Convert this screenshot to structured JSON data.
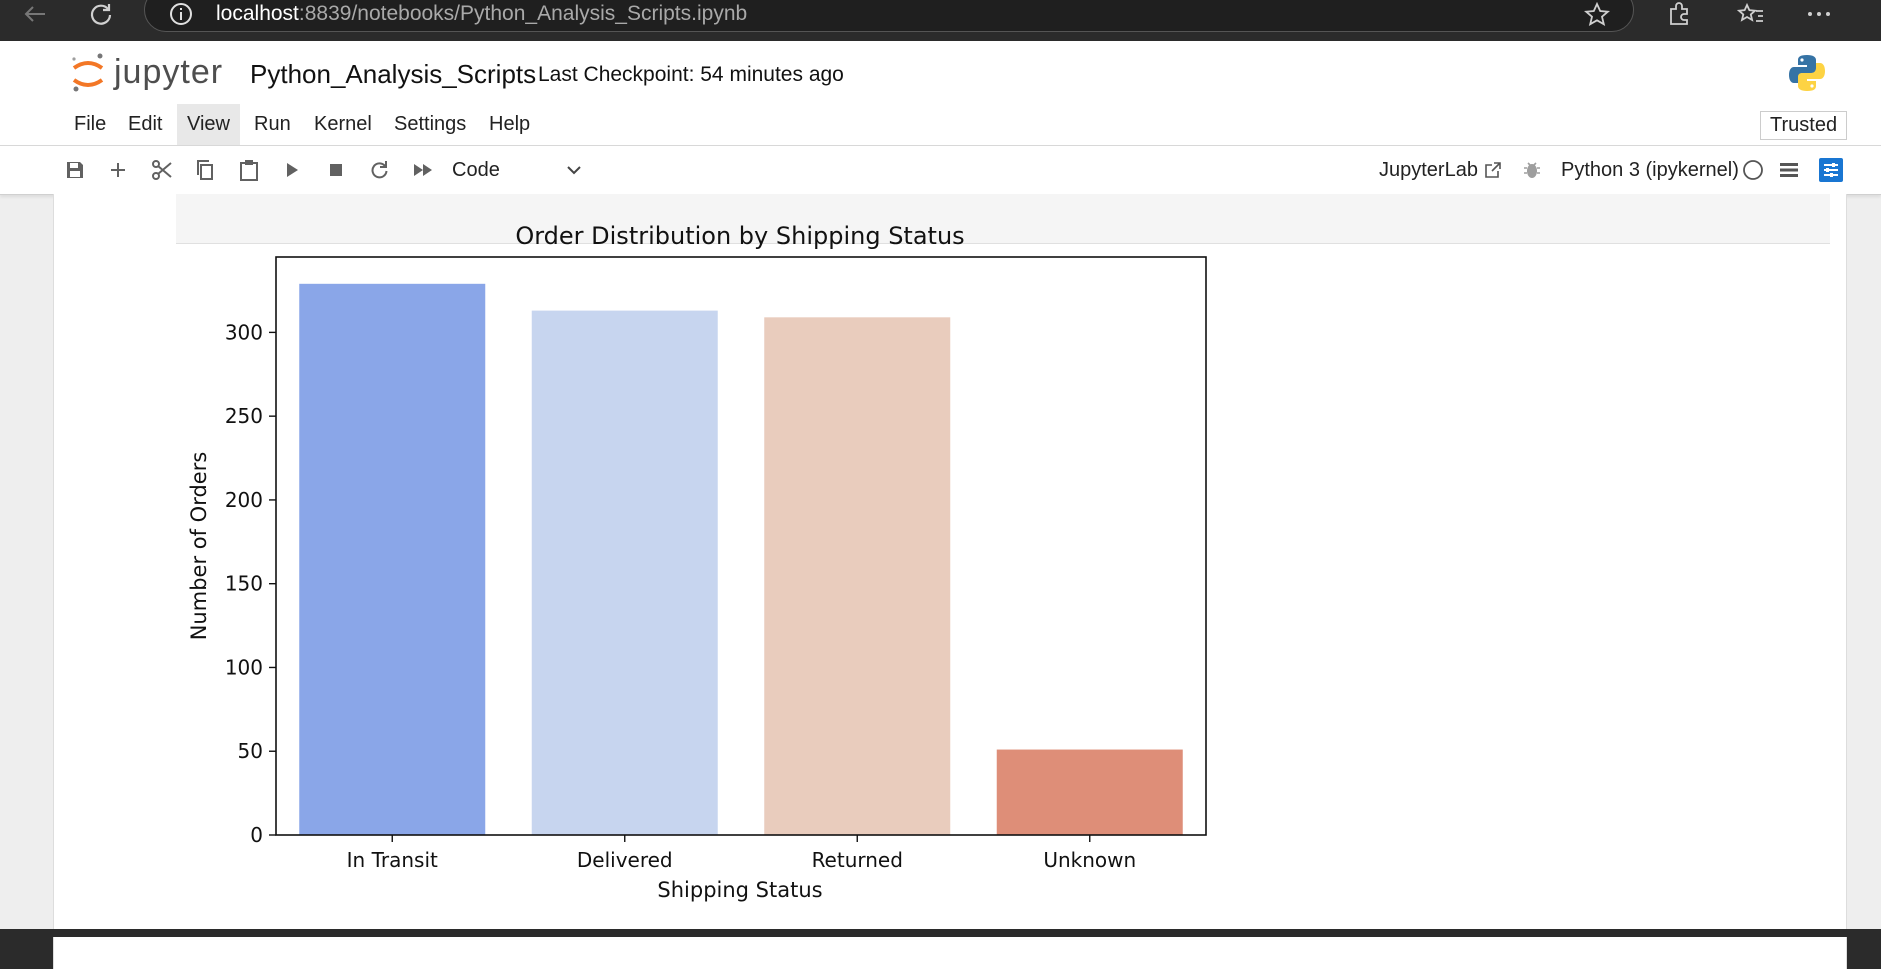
{
  "browser": {
    "url_host": "localhost",
    "url_rest": ":8839/notebooks/Python_Analysis_Scripts.ipynb"
  },
  "header": {
    "logo_text": "jupyter",
    "notebook_title": "Python_Analysis_Scripts",
    "checkpoint": "Last Checkpoint: 54 minutes ago"
  },
  "menu": {
    "items": [
      "File",
      "Edit",
      "View",
      "Run",
      "Kernel",
      "Settings",
      "Help"
    ],
    "active": "View",
    "trusted": "Trusted"
  },
  "toolbar": {
    "cell_type": "Code",
    "jupyterlab_label": "JupyterLab",
    "kernel_name": "Python 3 (ipykernel)"
  },
  "colors": {
    "accent": "#1976d2",
    "jupyter_orange": "#f37726"
  },
  "chart_data": {
    "type": "bar",
    "title": "Order Distribution by Shipping Status",
    "xlabel": "Shipping Status",
    "ylabel": "Number of Orders",
    "categories": [
      "In Transit",
      "Delivered",
      "Returned",
      "Unknown"
    ],
    "values": [
      329,
      313,
      309,
      51
    ],
    "colors": [
      "#8aa6e8",
      "#c7d5ef",
      "#e9ccbd",
      "#de8e78"
    ],
    "ylim": [
      0,
      345
    ],
    "yticks": [
      0,
      50,
      100,
      150,
      200,
      250,
      300
    ],
    "grid": false
  }
}
